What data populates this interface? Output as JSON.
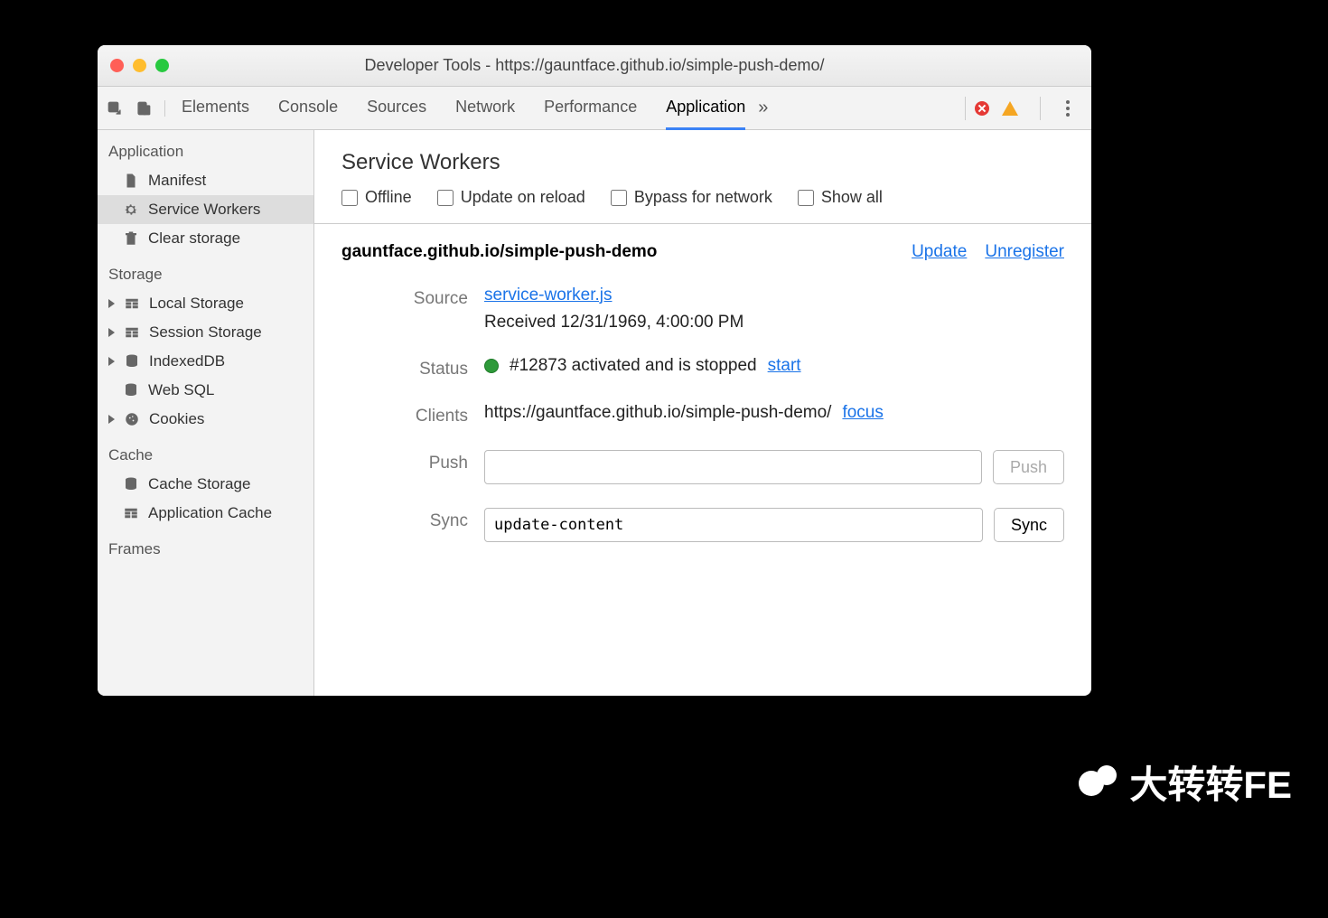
{
  "window": {
    "title": "Developer Tools - https://gauntface.github.io/simple-push-demo/"
  },
  "tabs": {
    "items": [
      "Elements",
      "Console",
      "Sources",
      "Network",
      "Performance",
      "Application"
    ],
    "active": "Application"
  },
  "sidebar": {
    "groups": [
      {
        "label": "Application",
        "items": [
          {
            "label": "Manifest",
            "icon": "file"
          },
          {
            "label": "Service Workers",
            "icon": "gear",
            "selected": true
          },
          {
            "label": "Clear storage",
            "icon": "trash"
          }
        ]
      },
      {
        "label": "Storage",
        "items": [
          {
            "label": "Local Storage",
            "icon": "table",
            "expandable": true
          },
          {
            "label": "Session Storage",
            "icon": "table",
            "expandable": true
          },
          {
            "label": "IndexedDB",
            "icon": "db",
            "expandable": true
          },
          {
            "label": "Web SQL",
            "icon": "db"
          },
          {
            "label": "Cookies",
            "icon": "cookie",
            "expandable": true
          }
        ]
      },
      {
        "label": "Cache",
        "items": [
          {
            "label": "Cache Storage",
            "icon": "db"
          },
          {
            "label": "Application Cache",
            "icon": "table"
          }
        ]
      },
      {
        "label": "Frames",
        "items": []
      }
    ]
  },
  "panel": {
    "title": "Service Workers",
    "options": [
      "Offline",
      "Update on reload",
      "Bypass for network",
      "Show all"
    ],
    "scope": "gauntface.github.io/simple-push-demo",
    "actions": {
      "update": "Update",
      "unregister": "Unregister"
    },
    "rows": {
      "source": {
        "label": "Source",
        "file": "service-worker.js",
        "received": "Received 12/31/1969, 4:00:00 PM"
      },
      "status": {
        "label": "Status",
        "text": "#12873 activated and is stopped",
        "action": "start"
      },
      "clients": {
        "label": "Clients",
        "url": "https://gauntface.github.io/simple-push-demo/",
        "action": "focus"
      },
      "push": {
        "label": "Push",
        "value": "",
        "button": "Push"
      },
      "sync": {
        "label": "Sync",
        "value": "update-content",
        "button": "Sync"
      }
    }
  },
  "watermark": "大转转FE"
}
